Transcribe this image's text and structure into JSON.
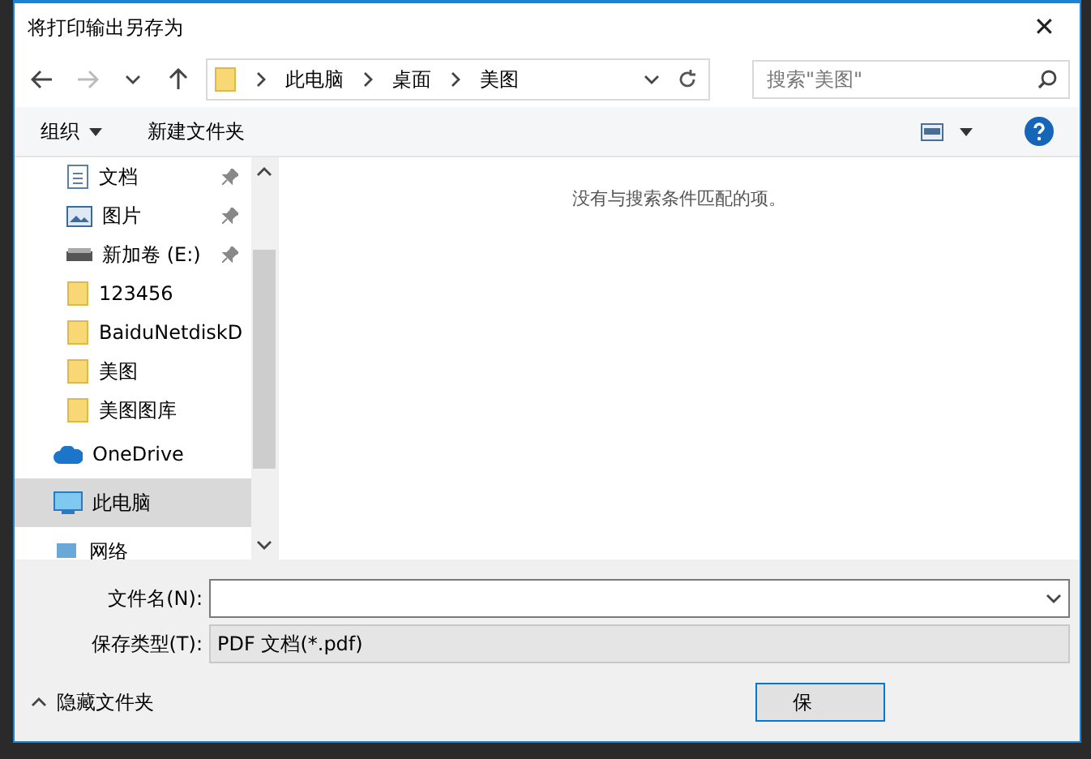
{
  "window": {
    "title": "将打印输出另存为",
    "close": "✕"
  },
  "address": {
    "crumbs": [
      "此电脑",
      "桌面",
      "美图"
    ],
    "search_placeholder": "搜索\"美图\""
  },
  "toolbar": {
    "organize": "组织",
    "new_folder": "新建文件夹"
  },
  "nav": [
    {
      "label": "文档",
      "kind": "doc",
      "pinned": true,
      "selected": false
    },
    {
      "label": "图片",
      "kind": "pic",
      "pinned": true,
      "selected": false
    },
    {
      "label": "新加卷 (E:)",
      "kind": "drive",
      "pinned": true,
      "selected": false
    },
    {
      "label": "123456",
      "kind": "folder",
      "pinned": false,
      "selected": false
    },
    {
      "label": "BaiduNetdiskD",
      "kind": "folder",
      "pinned": false,
      "selected": false
    },
    {
      "label": "美图",
      "kind": "folder",
      "pinned": false,
      "selected": false
    },
    {
      "label": "美图图库",
      "kind": "folder",
      "pinned": false,
      "selected": false
    },
    {
      "label": "OneDrive",
      "kind": "cloud",
      "pinned": false,
      "selected": false
    },
    {
      "label": "此电脑",
      "kind": "pc",
      "pinned": false,
      "selected": true
    },
    {
      "label": "网络",
      "kind": "net",
      "pinned": false,
      "selected": false
    }
  ],
  "empty_message": "没有与搜索条件匹配的项。",
  "form": {
    "filename_label": "文件名(N):",
    "filetype_label": "保存类型(T):",
    "filetype_value": "PDF 文档(*.pdf)"
  },
  "footer": {
    "hide_folders": "隐藏文件夹",
    "save_button": "保"
  }
}
